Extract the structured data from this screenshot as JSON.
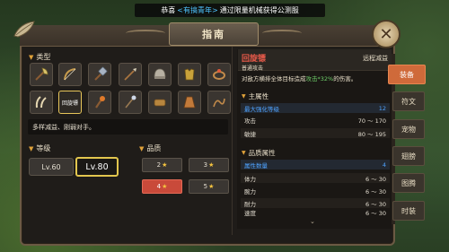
{
  "announcement": {
    "prefix": "恭喜",
    "player": "<有搞青年>",
    "suffix": "通过限量机械获得公测服"
  },
  "window": {
    "title": "指南",
    "close_glyph": "✕"
  },
  "category": {
    "title": "类型",
    "items": [
      {
        "icon": "axe-icon"
      },
      {
        "icon": "bow-icon"
      },
      {
        "icon": "hammer-icon"
      },
      {
        "icon": "spear-icon"
      },
      {
        "icon": "helmet-icon"
      },
      {
        "icon": "armor-icon"
      },
      {
        "icon": "ring-icon"
      },
      {
        "icon": "claw-icon"
      },
      {
        "label": "回旋镖",
        "selected": true
      },
      {
        "icon": "torch-icon"
      },
      {
        "icon": "staff-icon"
      },
      {
        "icon": "bracer-icon"
      },
      {
        "icon": "cloak-icon"
      },
      {
        "icon": "whip-icon"
      }
    ],
    "description": "多样减益、刚弱对手。"
  },
  "level": {
    "title": "等级",
    "options": [
      "Lv.60",
      "Lv.80"
    ],
    "selected": "Lv.80"
  },
  "quality": {
    "title": "品质",
    "options": [
      {
        "value": "2",
        "star": "★"
      },
      {
        "value": "3",
        "star": "★"
      },
      {
        "value": "4",
        "star": "★",
        "selected": true
      },
      {
        "value": "5",
        "star": "★"
      }
    ]
  },
  "item": {
    "name": "回旋镖",
    "type": "远程减益",
    "skill_name": "普通攻击",
    "skill_desc_pre": "对敌方横排全体目标造成",
    "skill_desc_hl": "攻击*32%",
    "skill_desc_post": "的伤害。",
    "main_attr_title": "主属性",
    "main_attrs": [
      {
        "name": "最大强化等级",
        "value": "12"
      },
      {
        "name": "攻击",
        "value": "70 ～ 170"
      },
      {
        "name": "敏捷",
        "value": "80 ～ 195"
      }
    ],
    "quality_attr_title": "品质属性",
    "quality_attrs": [
      {
        "name": "属性数量",
        "value": "4"
      },
      {
        "name": "体力",
        "value": "6 ～ 30"
      },
      {
        "name": "腕力",
        "value": "6 ～ 30"
      },
      {
        "name": "耐力",
        "value": "6 ～ 30"
      },
      {
        "name": "速度",
        "value": "6 ～ 30"
      }
    ],
    "scroll_glyph": "⌄"
  },
  "side_tabs": [
    "装备",
    "符文",
    "宠物",
    "翅膀",
    "图腾",
    "时装"
  ],
  "colors": {
    "accent": "#e0a23a",
    "item_name": "#e85a4a",
    "highlight_blue": "#4fa3ff",
    "highlight_green": "#6fd06a",
    "tab_active": "#cf6a3a",
    "quality_active": "#c94a3a",
    "level_active_border": "#e2c64e"
  }
}
